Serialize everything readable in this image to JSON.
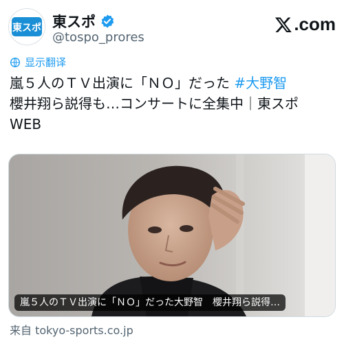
{
  "account": {
    "avatar_text": "東スポ",
    "display_name": "東スポ",
    "handle": "@tospo_prores",
    "verified_icon": "verified-badge-icon"
  },
  "brand": {
    "x_icon": "x-logo-icon",
    "domain_text": ".com"
  },
  "translate": {
    "icon": "globe-icon",
    "label": "显示翻译"
  },
  "post": {
    "text_before_hashtag": "嵐５人のＴＶ出演に「ＮＯ」だった ",
    "hashtag": "#大野智",
    "text_after_hashtag": "\n櫻井翔ら説得も…コンサートに全集中｜東スポ\nWEB"
  },
  "card": {
    "caption": "嵐５人のＴＶ出演に「ＮＯ」だった大野智　櫻井翔ら説得…",
    "source": "来自 tokyo-sports.co.jp"
  },
  "colors": {
    "link": "#1d9bf0",
    "secondary_text": "#536471",
    "logo_blue": "#1a8fd6"
  }
}
